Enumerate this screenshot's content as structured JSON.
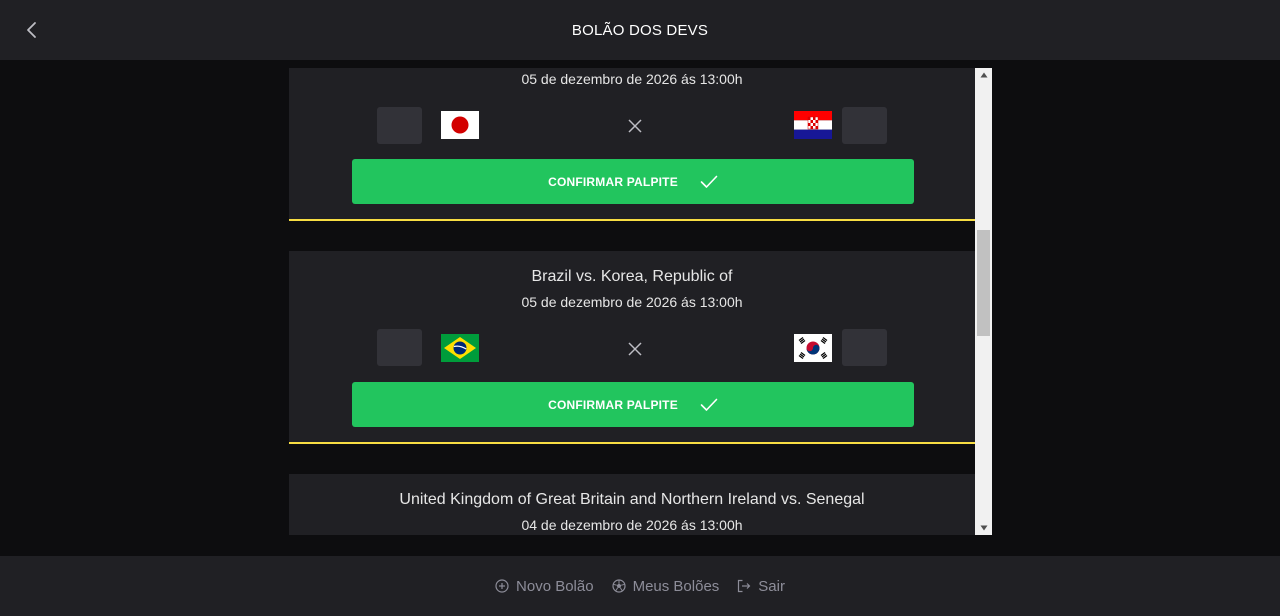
{
  "header": {
    "title": "BOLÃO DOS DEVS",
    "back_icon": "chevron-left-icon"
  },
  "games": [
    {
      "title": "",
      "date": "05 de dezembro de 2026 ás 13:00h",
      "home_flag": "Japan",
      "away_flag": "Croatia",
      "confirm_label": "CONFIRMAR PALPITE"
    },
    {
      "title": "Brazil vs. Korea, Republic of",
      "date": "05 de dezembro de 2026 ás 13:00h",
      "home_flag": "Brazil",
      "away_flag": "Korea, Republic of",
      "confirm_label": "CONFIRMAR PALPITE"
    },
    {
      "title": "United Kingdom of Great Britain and Northern Ireland vs. Senegal",
      "date": "04 de dezembro de 2026 ás 13:00h"
    }
  ],
  "footer": {
    "items": [
      {
        "label": "Novo Bolão",
        "icon": "plus-circle-icon"
      },
      {
        "label": "Meus Bolões",
        "icon": "soccer-ball-icon"
      },
      {
        "label": "Sair",
        "icon": "sign-out-icon"
      }
    ]
  },
  "colors": {
    "accent": "#22c55e",
    "highlight": "#f7dd43",
    "surface": "#202024",
    "background": "#0d0d0f"
  }
}
